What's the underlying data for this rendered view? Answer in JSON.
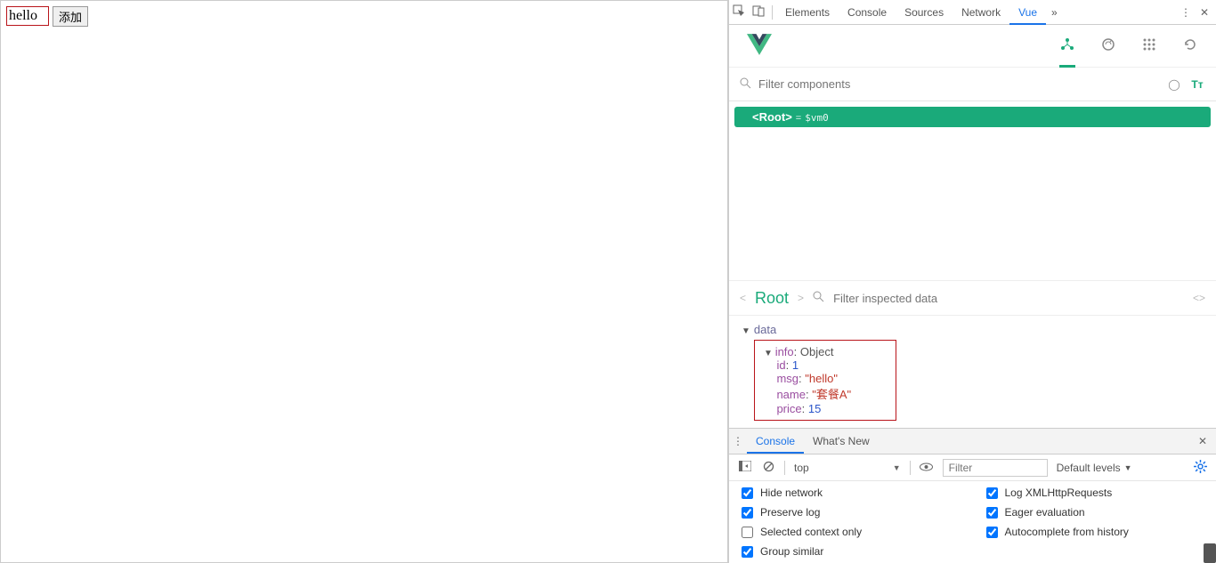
{
  "page": {
    "input_value": "hello",
    "button_label": "添加"
  },
  "devtools": {
    "tabs": [
      "Elements",
      "Console",
      "Sources",
      "Network",
      "Vue"
    ],
    "active_tab": "Vue"
  },
  "vue_panel": {
    "filter_placeholder": "Filter components",
    "root_label": "Root",
    "vm_ref": "$vm0",
    "inspector_label": "Root",
    "inspector_filter_placeholder": "Filter inspected data",
    "data_label": "data",
    "info_label": "info",
    "info_type": "Object",
    "props": {
      "id_key": "id",
      "id_val": "1",
      "msg_key": "msg",
      "msg_val": "\"hello\"",
      "name_key": "name",
      "name_val": "\"套餐A\"",
      "price_key": "price",
      "price_val": "15"
    }
  },
  "drawer": {
    "tabs": [
      "Console",
      "What's New"
    ],
    "active": "Console",
    "context": "top",
    "filter_placeholder": "Filter",
    "levels": "Default levels",
    "options": {
      "hide_network": "Hide network",
      "preserve_log": "Preserve log",
      "selected_ctx": "Selected context only",
      "group_similar": "Group similar",
      "log_xhr": "Log XMLHttpRequests",
      "eager_eval": "Eager evaluation",
      "autocomplete": "Autocomplete from history"
    }
  }
}
